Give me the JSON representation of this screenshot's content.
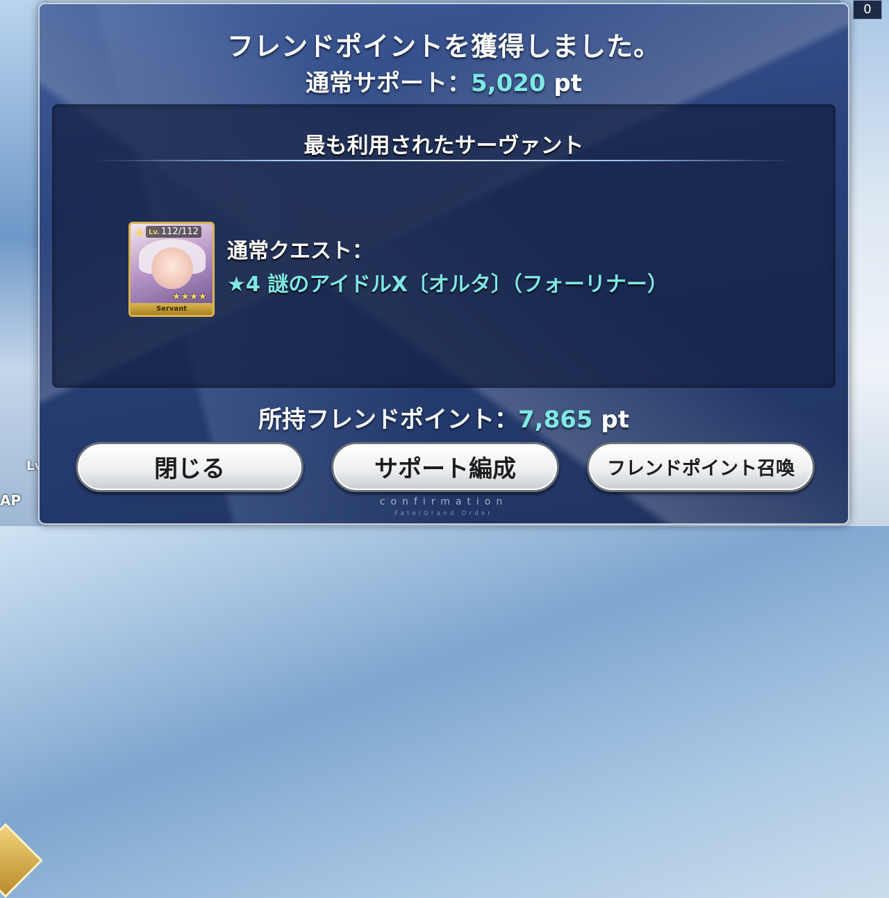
{
  "header": {
    "title": "フレンドポイントを獲得しました。",
    "normal_support_label": "通常サポート：",
    "normal_support_value": "5,020",
    "unit": "pt"
  },
  "most_used": {
    "heading": "最も利用されたサーヴァント",
    "card": {
      "level_prefix": "Lv.",
      "level": "112/112",
      "stars": "★★★★",
      "footer": "Servant",
      "icon": "servant-portrait"
    },
    "quest_label": "通常クエスト：",
    "servant_name": "★4 謎のアイドルX〔オルタ〕（フォーリナー）"
  },
  "owned": {
    "label": "所持フレンドポイント：",
    "value": "7,865",
    "unit": "pt"
  },
  "buttons": {
    "close": "閉じる",
    "support": "サポート編成",
    "summon": "フレンドポイント召喚"
  },
  "footer": {
    "text": "confirmation",
    "sub": "Fate/Grand Order"
  },
  "hud": {
    "counter": "0",
    "ap_label": "AP",
    "lv_label": "Lv."
  },
  "colors": {
    "accent_cyan": "#7fe7e4",
    "panel_blue": "#2b427a"
  }
}
